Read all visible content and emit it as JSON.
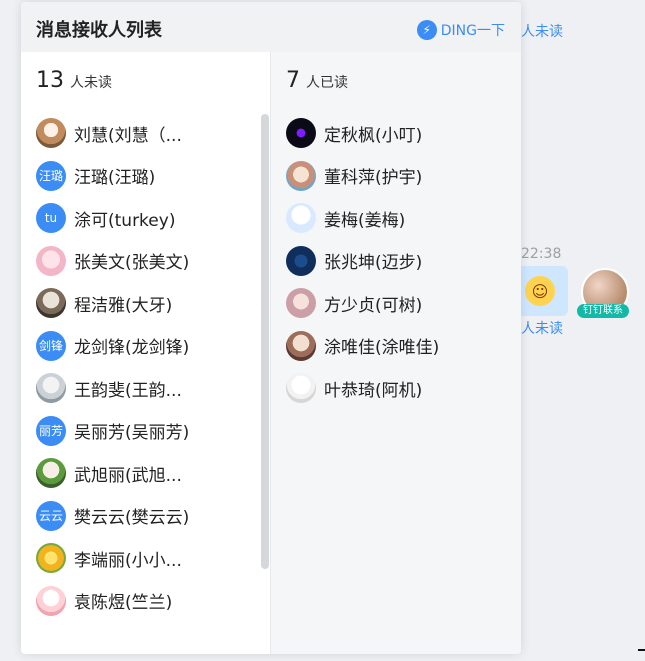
{
  "background": {
    "unread_top": "人未读",
    "time": "22:38",
    "unread_mid": "人未读",
    "badge": "钉钉联系"
  },
  "panel": {
    "title": "消息接收人列表",
    "ding_label": "DING一下",
    "icons": {
      "ding": "lightning-icon"
    }
  },
  "unread": {
    "count": "13",
    "label": "人未读",
    "items": [
      {
        "name": "刘慧(刘慧（...",
        "avatar_text": ""
      },
      {
        "name": "汪璐(汪璐)",
        "avatar_text": "汪璐"
      },
      {
        "name": "涂可(turkey)",
        "avatar_text": "tu"
      },
      {
        "name": "张美文(张美文)",
        "avatar_text": ""
      },
      {
        "name": "程洁雅(大牙)",
        "avatar_text": ""
      },
      {
        "name": "龙剑锋(龙剑锋)",
        "avatar_text": "剑锋"
      },
      {
        "name": "王韵斐(王韵...",
        "avatar_text": ""
      },
      {
        "name": "吴丽芳(吴丽芳)",
        "avatar_text": "丽芳"
      },
      {
        "name": "武旭丽(武旭...",
        "avatar_text": ""
      },
      {
        "name": "樊云云(樊云云)",
        "avatar_text": "云云"
      },
      {
        "name": "李端丽(小小...",
        "avatar_text": ""
      },
      {
        "name": "袁陈煜(竺兰)",
        "avatar_text": ""
      }
    ]
  },
  "read": {
    "count": "7",
    "label": "人已读",
    "items": [
      {
        "name": "定秋枫(小叮)"
      },
      {
        "name": "董科萍(护宇)"
      },
      {
        "name": "姜梅(姜梅)"
      },
      {
        "name": "张兆坤(迈步)"
      },
      {
        "name": "方少贞(可树)"
      },
      {
        "name": "涂唯佳(涂唯佳)"
      },
      {
        "name": "叶恭琦(阿机)"
      }
    ]
  },
  "colors": {
    "accent": "#3b8cf5",
    "panel_bg": "#ffffff",
    "header_bg": "#f1f2f4",
    "page_bg": "#eef0f3"
  }
}
